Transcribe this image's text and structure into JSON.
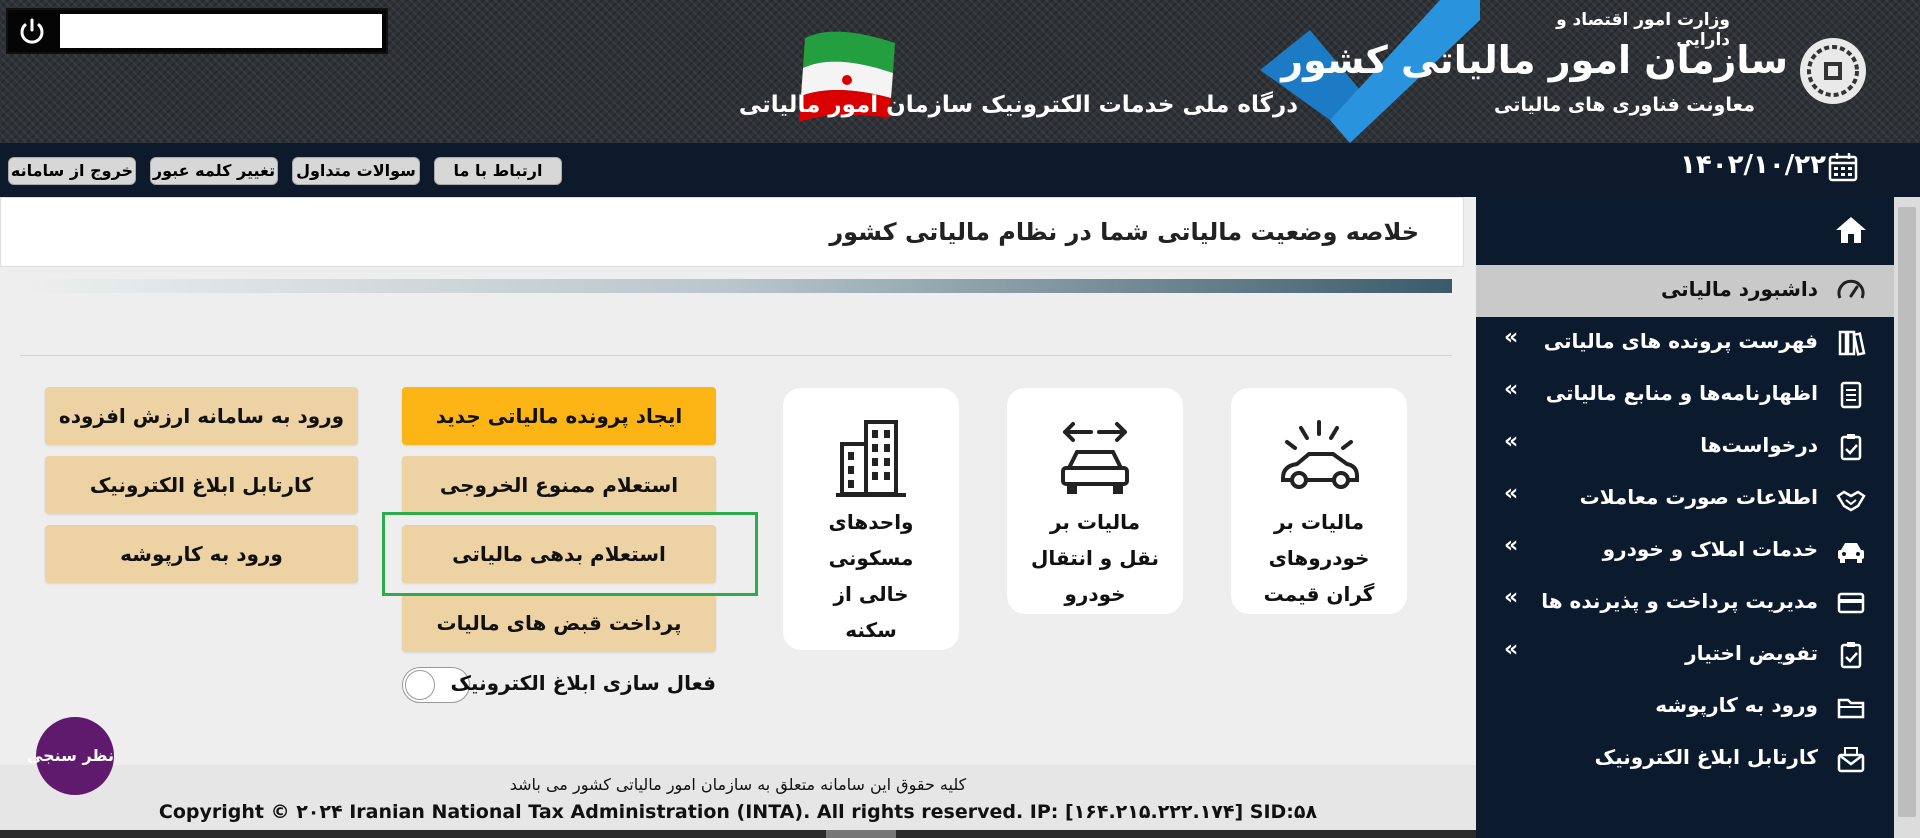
{
  "header": {
    "ministry": "وزارت امور اقتصاد و دارایی",
    "organization": "سازمان امور مالیاتی کشور",
    "deputy": "معاونت فناوری های مالیاتی",
    "portal_subtitle": "درگاه ملی خدمات الکترونیک سازمان امور مالیاتی"
  },
  "topbar": {
    "logout": "خروج از سامانه",
    "change_password": "تغییر کلمه عبور",
    "faq": "سوالات متداول",
    "contact": "ارتباط با ما",
    "date": "۱۴۰۲/۱۰/۲۲"
  },
  "main": {
    "summary_title": "خلاصه وضعیت مالیاتی شما در نظام مالیاتی کشور",
    "buttons_left": [
      "ورود به سامانه ارزش افزوده",
      "کارتابل ابلاغ الکترونیک",
      "ورود به کارپوشه"
    ],
    "buttons_mid": [
      "ایجاد پرونده مالیاتی جدید",
      "استعلام ممنوع الخروجی",
      "استعلام بدهی مالیاتی",
      "پرداخت قبض های مالیات"
    ],
    "toggle_label": "فعال سازی ابلاغ الکترونیک",
    "cards": [
      {
        "lines": [
          "واحدهای",
          "مسکونی",
          "خالی از",
          "سکنه"
        ],
        "icon": "building-icon"
      },
      {
        "lines": [
          "مالیات بر",
          "نقل و انتقال",
          "خودرو"
        ],
        "icon": "car-transfer-icon"
      },
      {
        "lines": [
          "مالیات بر",
          "خودروهای",
          "گران قیمت"
        ],
        "icon": "luxury-car-icon"
      }
    ],
    "footer_rights": "کلیه حقوق این سامانه متعلق به سازمان امور مالیاتی کشور می باشد",
    "footer_copyright": "Copyright © ۲۰۲۴ Iranian National Tax Administration (INTA). All rights reserved. IP: [۱۶۴.۲۱۵.۲۲۲.۱۷۴] SID:۵۸",
    "survey": "نظر سنجی"
  },
  "sidebar": {
    "items": [
      {
        "label": "داشبورد مالیاتی",
        "icon": "dashboard-icon"
      },
      {
        "label": "فهرست پرونده های مالیاتی",
        "icon": "files-icon"
      },
      {
        "label": "اظهارنامه‌ها و منابع مالیاتی",
        "icon": "document-icon"
      },
      {
        "label": "درخواست‌ها",
        "icon": "request-icon"
      },
      {
        "label": "اطلاعات صورت معاملات",
        "icon": "handshake-icon"
      },
      {
        "label": "خدمات املاک و خودرو",
        "icon": "car-icon"
      },
      {
        "label": "مدیریت پرداخت و پذیرنده ها",
        "icon": "card-icon"
      },
      {
        "label": "تفویض اختیار",
        "icon": "delegate-icon"
      },
      {
        "label": "ورود به کارپوشه",
        "icon": "folder-icon"
      },
      {
        "label": "کارتابل ابلاغ الکترونیک",
        "icon": "envelope-icon"
      }
    ]
  },
  "colors": {
    "header_bg": "#2e3236",
    "sidebar_bg": "#0b1a2c",
    "button_tan": "#edd2a4",
    "button_primary": "#fdb515",
    "highlight_green": "#2eab4a",
    "survey_purple": "#5f1a6e"
  }
}
